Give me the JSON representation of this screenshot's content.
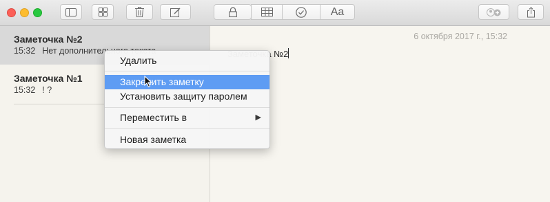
{
  "toolbar": {
    "buttons": [
      {
        "name": "toggle-sidebar-button",
        "icon": "sidebar-icon"
      },
      {
        "name": "attachments-browser-button",
        "icon": "grid-icon"
      },
      {
        "name": "delete-button",
        "icon": "trash-icon"
      },
      {
        "name": "new-note-button",
        "icon": "compose-icon"
      },
      {
        "name": "lock-button",
        "icon": "lock-icon"
      },
      {
        "name": "table-button",
        "icon": "table-icon"
      },
      {
        "name": "checklist-button",
        "icon": "checkmark-circle-icon"
      },
      {
        "name": "format-button",
        "icon": "text-format-icon",
        "label": "Aa"
      },
      {
        "name": "add-people-button",
        "icon": "add-people-icon"
      },
      {
        "name": "share-button",
        "icon": "share-icon"
      }
    ]
  },
  "sidebar": {
    "notes": [
      {
        "title": "Заметочка №2",
        "time": "15:32",
        "preview": "Нет дополнительного текста"
      },
      {
        "title": "Заметочка №1",
        "time": "15:32",
        "preview": "! ?"
      }
    ]
  },
  "editor": {
    "date": "6 октября 2017 г., 15:32",
    "body": "Заметочка №2"
  },
  "context_menu": {
    "items": [
      {
        "label": "Удалить"
      },
      {
        "label": "Закрепить заметку",
        "highlighted": true
      },
      {
        "label": "Установить защиту паролем"
      },
      {
        "label": "Переместить в",
        "submenu_arrow": "▶"
      },
      {
        "label": "Новая заметка"
      }
    ],
    "highlight_color": "#5e9cf3"
  }
}
